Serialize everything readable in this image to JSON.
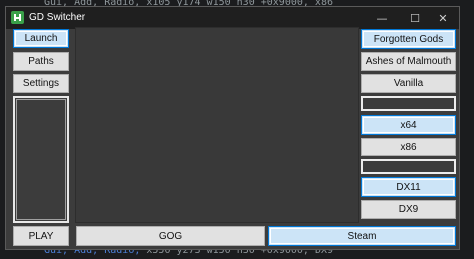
{
  "background": {
    "code_top": "Gui, Add, Radio, x105 y174 w150 h30 +0x9000, x86",
    "code_bottom_kw1": "Gui,",
    "code_bottom_kw2": "Add,",
    "code_bottom_kw3": "Radio,",
    "code_bottom_rest": " x550 y273 w150 h30 +0x9000, DX9"
  },
  "window": {
    "title": "GD Switcher",
    "minimize_glyph": "—",
    "maximize_glyph": "☐",
    "close_glyph": "✕"
  },
  "left_menu": {
    "launch": "Launch",
    "paths": "Paths",
    "settings": "Settings",
    "play": "PLAY"
  },
  "right_options": {
    "forgotten_gods": "Forgotten Gods",
    "ashes_of_malmouth": "Ashes of Malmouth",
    "vanilla": "Vanilla",
    "x64": "x64",
    "x86": "x86",
    "dx11": "DX11",
    "dx9": "DX9"
  },
  "bottom_bar": {
    "gog": "GOG",
    "steam": "Steam"
  },
  "colors": {
    "window_bg": "#3c3c3c",
    "selected_bg": "#cce4f7",
    "selected_border": "#0078d7",
    "button_bg": "#e1e1e1"
  }
}
